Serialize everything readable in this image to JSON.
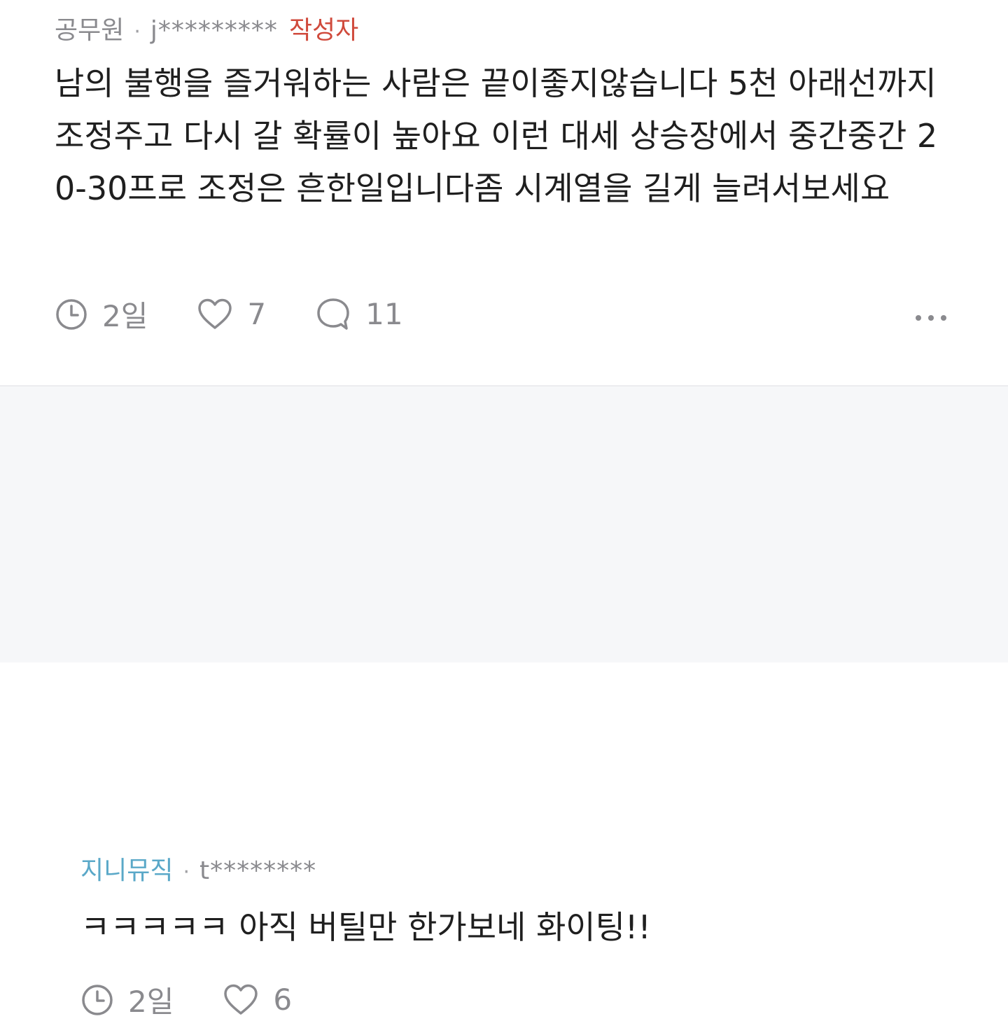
{
  "comment": {
    "nickname": "공무원",
    "separator": "·",
    "user_id": "j*********",
    "author_badge": "작성자",
    "text": "남의 불행을 즐거워하는 사람은 끝이좋지않습니다 5천 아래선까지 조정주고 다시 갈 확률이 높아요 이런 대세 상승장에서 중간중간 20-30프로 조정은 흔한일입니다좀 시계열을 길게 늘려서보세요",
    "time": "2일",
    "likes": "7",
    "replies": "11",
    "icons": {
      "time": "clock-icon",
      "like": "heart-icon",
      "reply": "speech-bubble-icon",
      "more": "more-dots-icon"
    }
  },
  "reply": {
    "nickname": "지니뮤직",
    "separator": "·",
    "user_id": "t********",
    "text": "ㅋㅋㅋㅋㅋ 아직 버틸만 한가보네 화이팅!!",
    "time": "2일",
    "likes": "6",
    "icons": {
      "time": "clock-icon",
      "like": "heart-icon"
    }
  },
  "colors": {
    "author_badge": "#d04a3c",
    "reply_nickname": "#5aa8c8",
    "meta_gray": "#8a8a8e",
    "reply_background": "#f6f7f9"
  }
}
